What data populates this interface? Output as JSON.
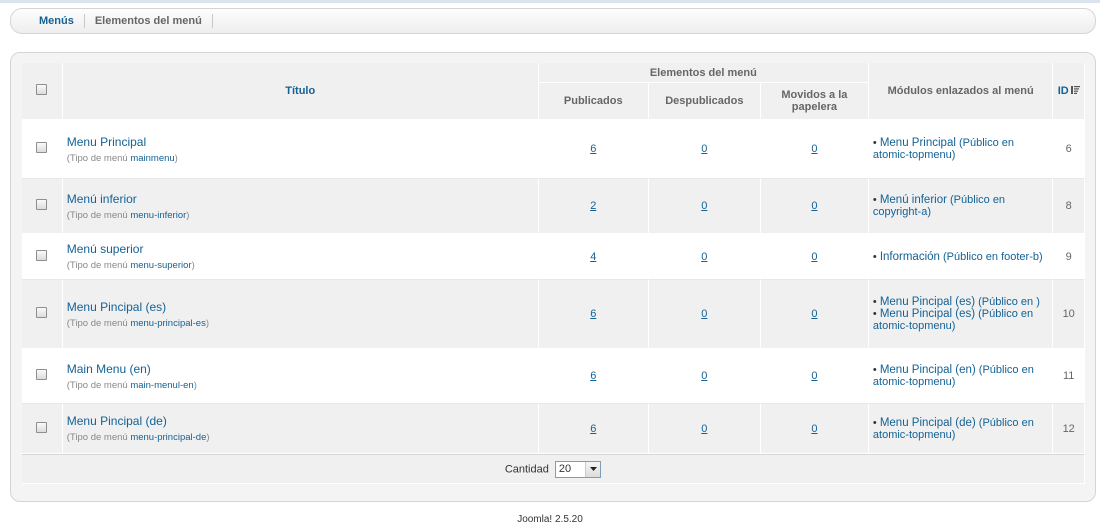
{
  "submenu": {
    "tabs": [
      {
        "label": "Menús",
        "active": true
      },
      {
        "label": "Elementos del menú",
        "active": false
      }
    ]
  },
  "table": {
    "headers": {
      "title": "Título",
      "group": "Elementos del menú",
      "published": "Publicados",
      "unpublished": "Despublicados",
      "trashed": "Movidos a la papelera",
      "modules": "Módulos enlazados al menú",
      "id": "ID"
    },
    "type_prefix": "(Tipo de menú ",
    "rows": [
      {
        "title": "Menu Principal",
        "menutype": "mainmenu",
        "published": "6",
        "unpublished": "0",
        "trashed": "0",
        "modules": [
          {
            "name": "Menu Principal",
            "access": "(Público en atomic-topmenu)"
          }
        ],
        "id": "6"
      },
      {
        "title": "Menú inferior",
        "menutype": "menu-inferior",
        "published": "2",
        "unpublished": "0",
        "trashed": "0",
        "modules": [
          {
            "name": "Menú inferior",
            "access": "(Público en copyright-a)"
          }
        ],
        "id": "8"
      },
      {
        "title": "Menú superior",
        "menutype": "menu-superior",
        "published": "4",
        "unpublished": "0",
        "trashed": "0",
        "modules": [
          {
            "name": "Información",
            "access": "(Público en footer-b)"
          }
        ],
        "id": "9"
      },
      {
        "title": "Menu Pincipal (es)",
        "menutype": "menu-principal-es",
        "published": "6",
        "unpublished": "0",
        "trashed": "0",
        "modules": [
          {
            "name": "Menu Pincipal (es)",
            "access": "(Público en )"
          },
          {
            "name": "Menu Pincipal (es)",
            "access": "(Público en atomic-topmenu)"
          }
        ],
        "id": "10"
      },
      {
        "title": "Main Menu (en)",
        "menutype": "main-menul-en",
        "published": "6",
        "unpublished": "0",
        "trashed": "0",
        "modules": [
          {
            "name": "Menu Pincipal (en)",
            "access": "(Público en atomic-topmenu)"
          }
        ],
        "id": "11"
      },
      {
        "title": "Menu Pincipal (de)",
        "menutype": "menu-principal-de",
        "published": "6",
        "unpublished": "0",
        "trashed": "0",
        "modules": [
          {
            "name": "Menu Pincipal (de)",
            "access": "(Público en atomic-topmenu)"
          }
        ],
        "id": "12"
      }
    ]
  },
  "footer": {
    "limit_label": "Cantidad",
    "limit_value": "20"
  },
  "version": "Joomla! 2.5.20",
  "icons": {
    "checkbox": "checkbox-icon",
    "sort": "sort-icon",
    "dropdown": "chevron-down-icon"
  }
}
